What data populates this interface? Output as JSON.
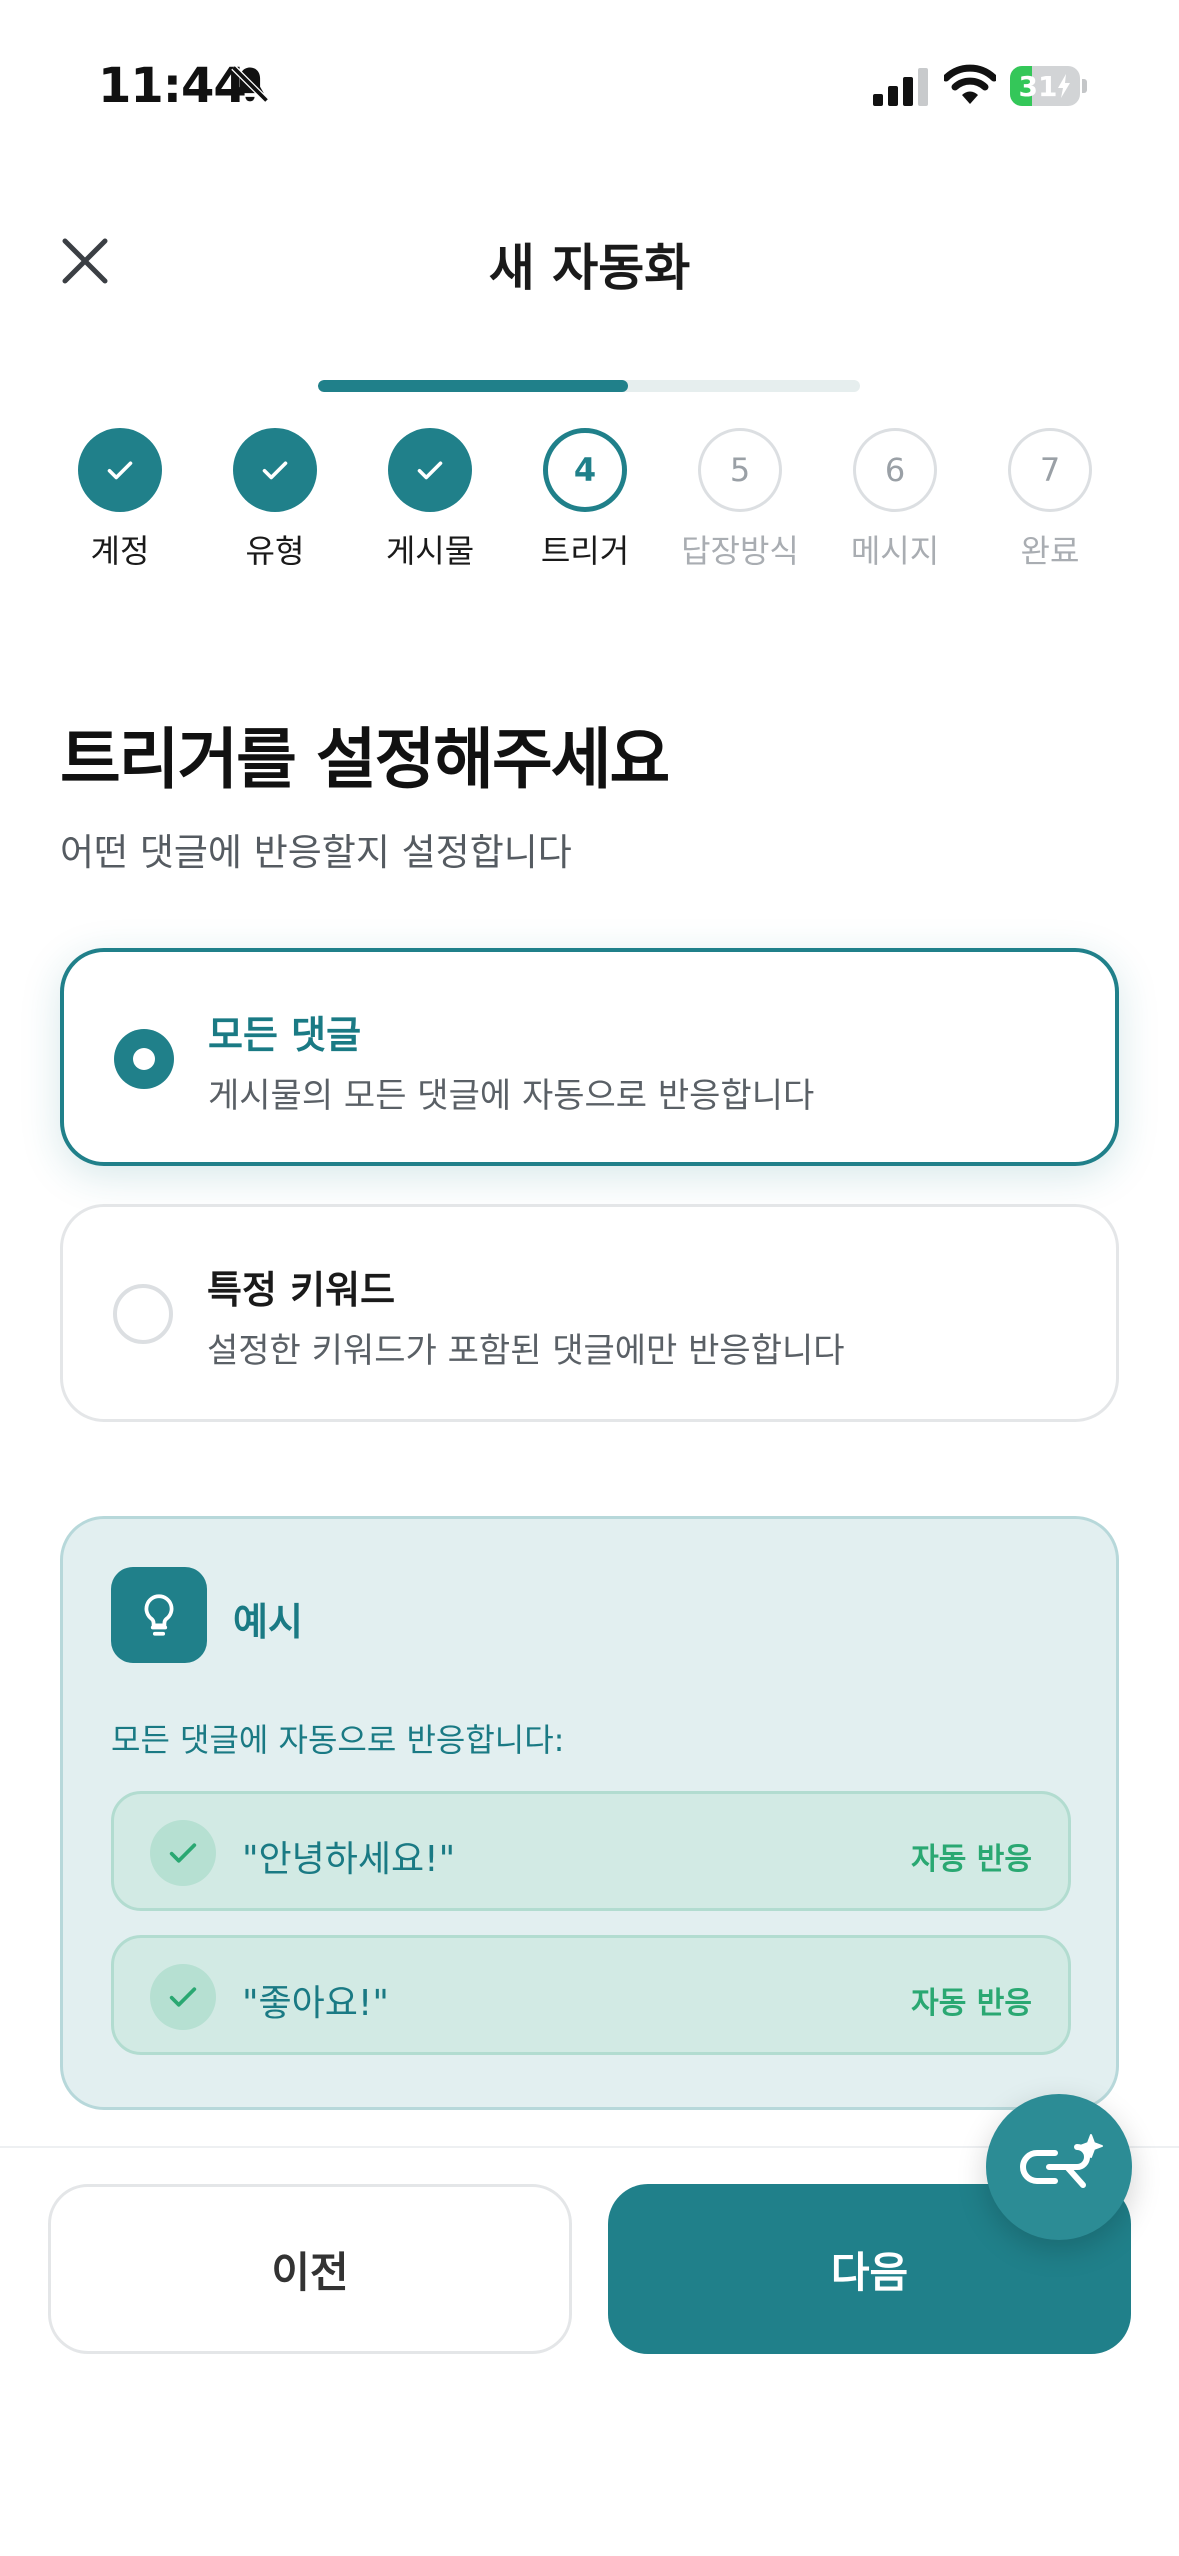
{
  "status_bar": {
    "time": "11:44",
    "battery_percent": "31",
    "battery_level": 0.31,
    "icons": [
      "bell-slash-icon",
      "cellular-signal-icon",
      "wifi-icon",
      "battery-charging-icon"
    ]
  },
  "header": {
    "title": "새 자동화",
    "close_icon": "close-icon"
  },
  "progress": {
    "fraction": 0.5714
  },
  "steps": [
    {
      "number": "1",
      "label": "계정",
      "state": "done"
    },
    {
      "number": "2",
      "label": "유형",
      "state": "done"
    },
    {
      "number": "3",
      "label": "게시물",
      "state": "done"
    },
    {
      "number": "4",
      "label": "트리거",
      "state": "current"
    },
    {
      "number": "5",
      "label": "답장방식",
      "state": "todo"
    },
    {
      "number": "6",
      "label": "메시지",
      "state": "todo"
    },
    {
      "number": "7",
      "label": "완료",
      "state": "todo"
    }
  ],
  "main": {
    "heading": "트리거를 설정해주세요",
    "subtitle": "어떤 댓글에 반응할지 설정합니다",
    "options": [
      {
        "title": "모든 댓글",
        "description": "게시물의 모든 댓글에 자동으로 반응합니다",
        "selected": true
      },
      {
        "title": "특정 키워드",
        "description": "설정한 키워드가 포함된 댓글에만 반응합니다",
        "selected": false
      }
    ]
  },
  "example": {
    "icon": "lightbulb-icon",
    "title": "예시",
    "description": "모든 댓글에 자동으로 반응합니다:",
    "items": [
      {
        "text": "\"안녕하세요!\"",
        "badge": "자동 반응"
      },
      {
        "text": "\"좋아요!\"",
        "badge": "자동 반응"
      }
    ]
  },
  "footer": {
    "prev_label": "이전",
    "next_label": "다음",
    "fab_icon": "ai-sparkle-icon"
  },
  "colors": {
    "accent": "#20808a",
    "success": "#2aa872",
    "example_bg": "#e2eff0"
  }
}
